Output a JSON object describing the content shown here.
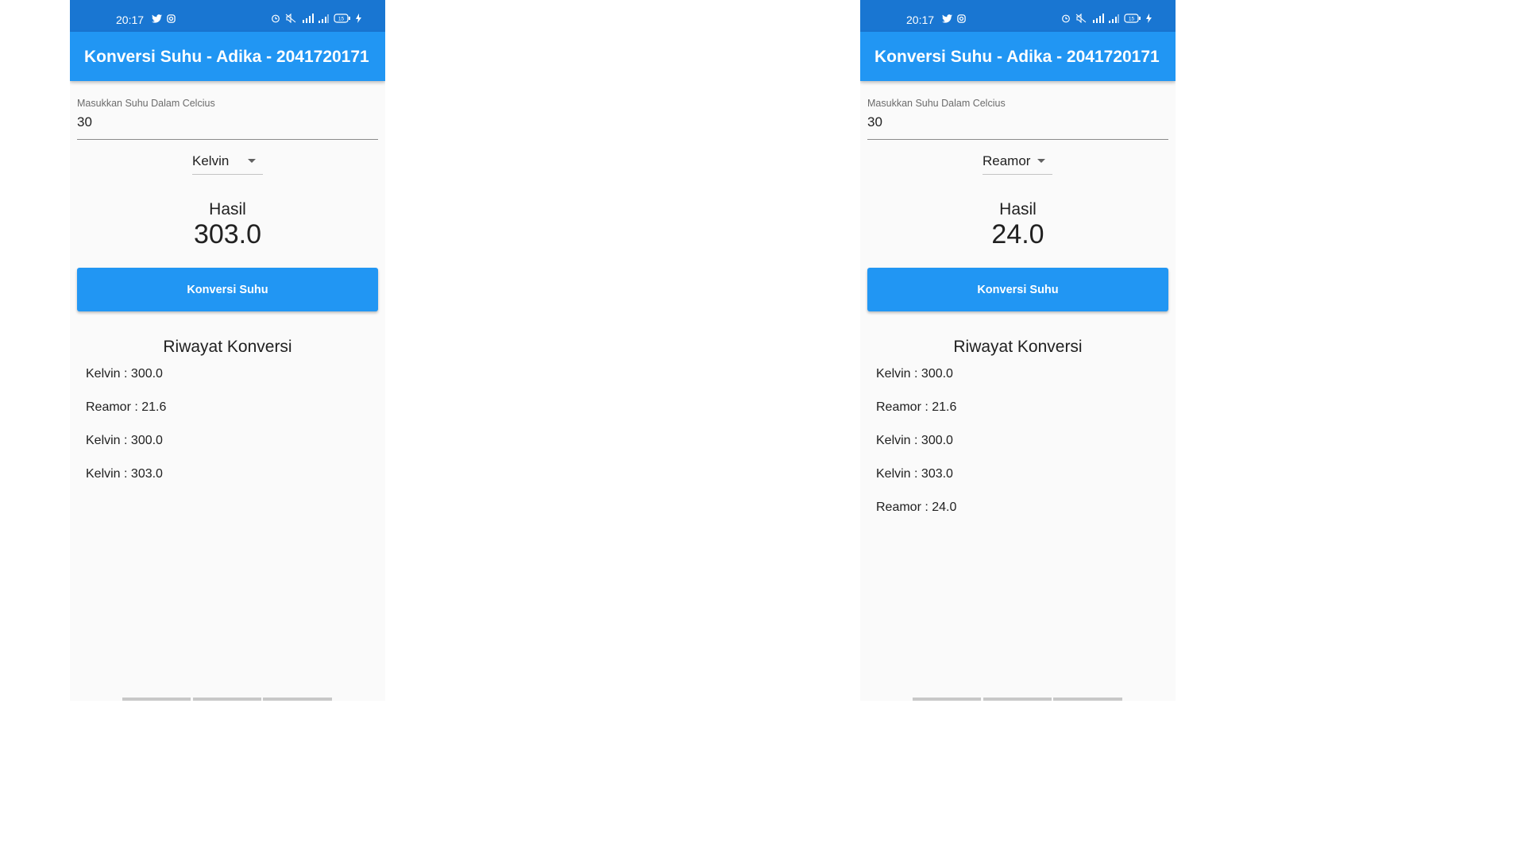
{
  "phones": [
    {
      "status_bar": {
        "time": "20:17",
        "battery": "15"
      },
      "app_bar": {
        "title": "Konversi Suhu - Adika - 2041720171"
      },
      "input": {
        "label": "Masukkan Suhu Dalam Celcius",
        "value": "30"
      },
      "dropdown": {
        "selected": "Kelvin"
      },
      "result": {
        "label": "Hasil",
        "value": "303.0"
      },
      "convert_button": {
        "label": "Konversi Suhu"
      },
      "history": {
        "title": "Riwayat Konversi",
        "items": [
          "Kelvin : 300.0",
          "Reamor : 21.6",
          "Kelvin : 300.0",
          "Kelvin : 303.0"
        ]
      }
    },
    {
      "status_bar": {
        "time": "20:17",
        "battery": "15"
      },
      "app_bar": {
        "title": "Konversi Suhu - Adika - 2041720171"
      },
      "input": {
        "label": "Masukkan Suhu Dalam Celcius",
        "value": "30"
      },
      "dropdown": {
        "selected": "Reamor"
      },
      "result": {
        "label": "Hasil",
        "value": "24.0"
      },
      "convert_button": {
        "label": "Konversi Suhu"
      },
      "history": {
        "title": "Riwayat Konversi",
        "items": [
          "Kelvin : 300.0",
          "Reamor : 21.6",
          "Kelvin : 300.0",
          "Kelvin : 303.0",
          "Reamor : 24.0"
        ]
      }
    }
  ],
  "colors": {
    "status_bar": "#1976d2",
    "app_bar": "#2196f3",
    "button": "#2196f3",
    "background": "#fafafa"
  },
  "icons": [
    "twitter-icon",
    "instagram-icon",
    "alarm-icon",
    "mute-icon",
    "signal-4g-icon",
    "signal-icon",
    "battery-icon",
    "charging-icon"
  ]
}
